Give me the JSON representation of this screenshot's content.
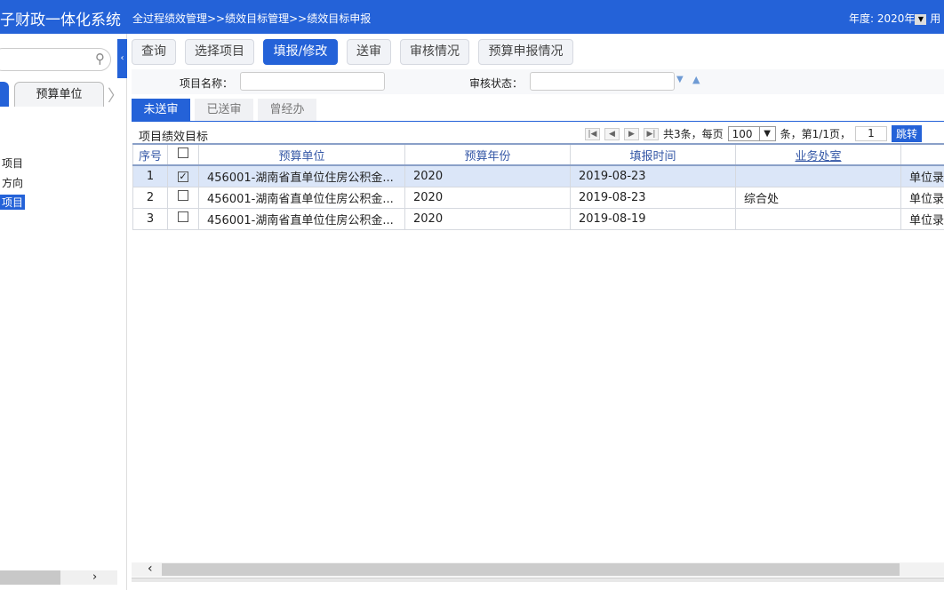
{
  "header": {
    "title": "子财政一体化系统",
    "breadcrumb": "全过程绩效管理>>绩效目标管理>>绩效目标申报",
    "year_label": "年度: 2020年",
    "user_label": "用"
  },
  "left": {
    "tabs": [
      "",
      "预算单位"
    ],
    "tree": [
      "项目",
      "方向",
      "项目"
    ]
  },
  "toolbar": [
    "查询",
    "选择项目",
    "填报/修改",
    "送审",
    "审核情况",
    "预算申报情况"
  ],
  "filter": {
    "name_label": "项目名称：",
    "name_value": "",
    "status_label": "审核状态：",
    "status_value": ""
  },
  "tabs": [
    "未送审",
    "已送审",
    "曾经办"
  ],
  "grid": {
    "title": "项目绩效目标",
    "pager": {
      "total": "共3条，每页",
      "page_size": "100",
      "mid": "条，第1/1页，",
      "page": "1",
      "go": "跳转"
    },
    "columns": [
      "序号",
      "",
      "预算单位",
      "预算年份",
      "填报时间",
      "业务处室",
      ""
    ],
    "rows": [
      {
        "no": "1",
        "checked": true,
        "unit": "456001-湖南省直单位住房公积金...",
        "year": "2020",
        "date": "2019-08-23",
        "office": "",
        "status": "单位录"
      },
      {
        "no": "2",
        "checked": false,
        "unit": "456001-湖南省直单位住房公积金...",
        "year": "2020",
        "date": "2019-08-23",
        "office": "综合处",
        "status": "单位录"
      },
      {
        "no": "3",
        "checked": false,
        "unit": "456001-湖南省直单位住房公积金...",
        "year": "2020",
        "date": "2019-08-19",
        "office": "",
        "status": "单位录"
      }
    ]
  },
  "colors": {
    "accent": "#2462d8",
    "selected_row": "#dbe6f8"
  }
}
